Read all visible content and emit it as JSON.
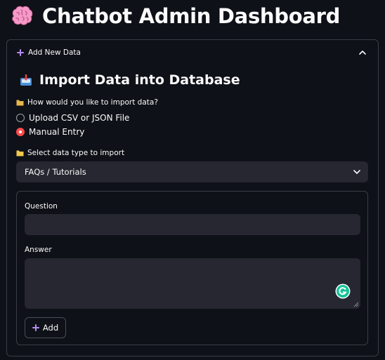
{
  "page": {
    "title": "Chatbot Admin Dashboard",
    "title_icon": "brain-icon"
  },
  "expander": {
    "label": "Add New Data",
    "expanded": true,
    "section_title": "Import Data into Database",
    "section_icon": "inbox-tray-icon"
  },
  "import_method": {
    "label": "How would you like to import data?",
    "options": [
      {
        "label": "Upload CSV or JSON File",
        "selected": false
      },
      {
        "label": "Manual Entry",
        "selected": true
      }
    ]
  },
  "data_type": {
    "label": "Select data type to import",
    "selected": "FAQs / Tutorials"
  },
  "form": {
    "question_label": "Question",
    "question_value": "",
    "answer_label": "Answer",
    "answer_value": "",
    "add_label": "Add"
  },
  "colors": {
    "background": "#0e1117",
    "input_bg": "#262730",
    "accent_radio": "#ff4b4b",
    "accent_plus": "#b78cf2",
    "border": "#3a3d46"
  }
}
